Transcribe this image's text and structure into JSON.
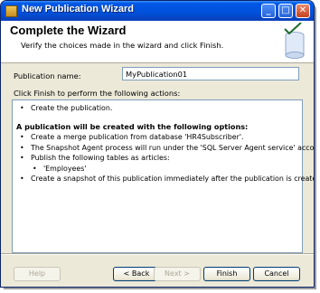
{
  "window": {
    "title": "New Publication Wizard",
    "minimize_glyph": "_",
    "maximize_glyph": "□",
    "close_glyph": "✕"
  },
  "header": {
    "title": "Complete the Wizard",
    "subtitle": "Verify the choices made in the wizard and click Finish."
  },
  "form": {
    "publication_name_label": "Publication name:",
    "publication_name_value": "MyPublication01",
    "finish_instructions": "Click Finish to perform the following actions:"
  },
  "actions": {
    "bullet": "•",
    "first": "Create the publication.",
    "heading": "A publication will be created with the following options:",
    "items": [
      "Create a merge publication from database 'HR4Subscriber'.",
      "The Snapshot Agent process will run under the 'SQL Server Agent service' account.",
      "Publish the following tables as articles:"
    ],
    "articles": [
      "'Employees'"
    ],
    "last": "Create a snapshot of this publication immediately after the publication is created."
  },
  "buttons": {
    "help": "Help",
    "back": "< Back",
    "next": "Next >",
    "finish": "Finish",
    "cancel": "Cancel"
  },
  "icons": {
    "app": "wizard-app-icon",
    "header_graphic": "publication-database-icon"
  }
}
